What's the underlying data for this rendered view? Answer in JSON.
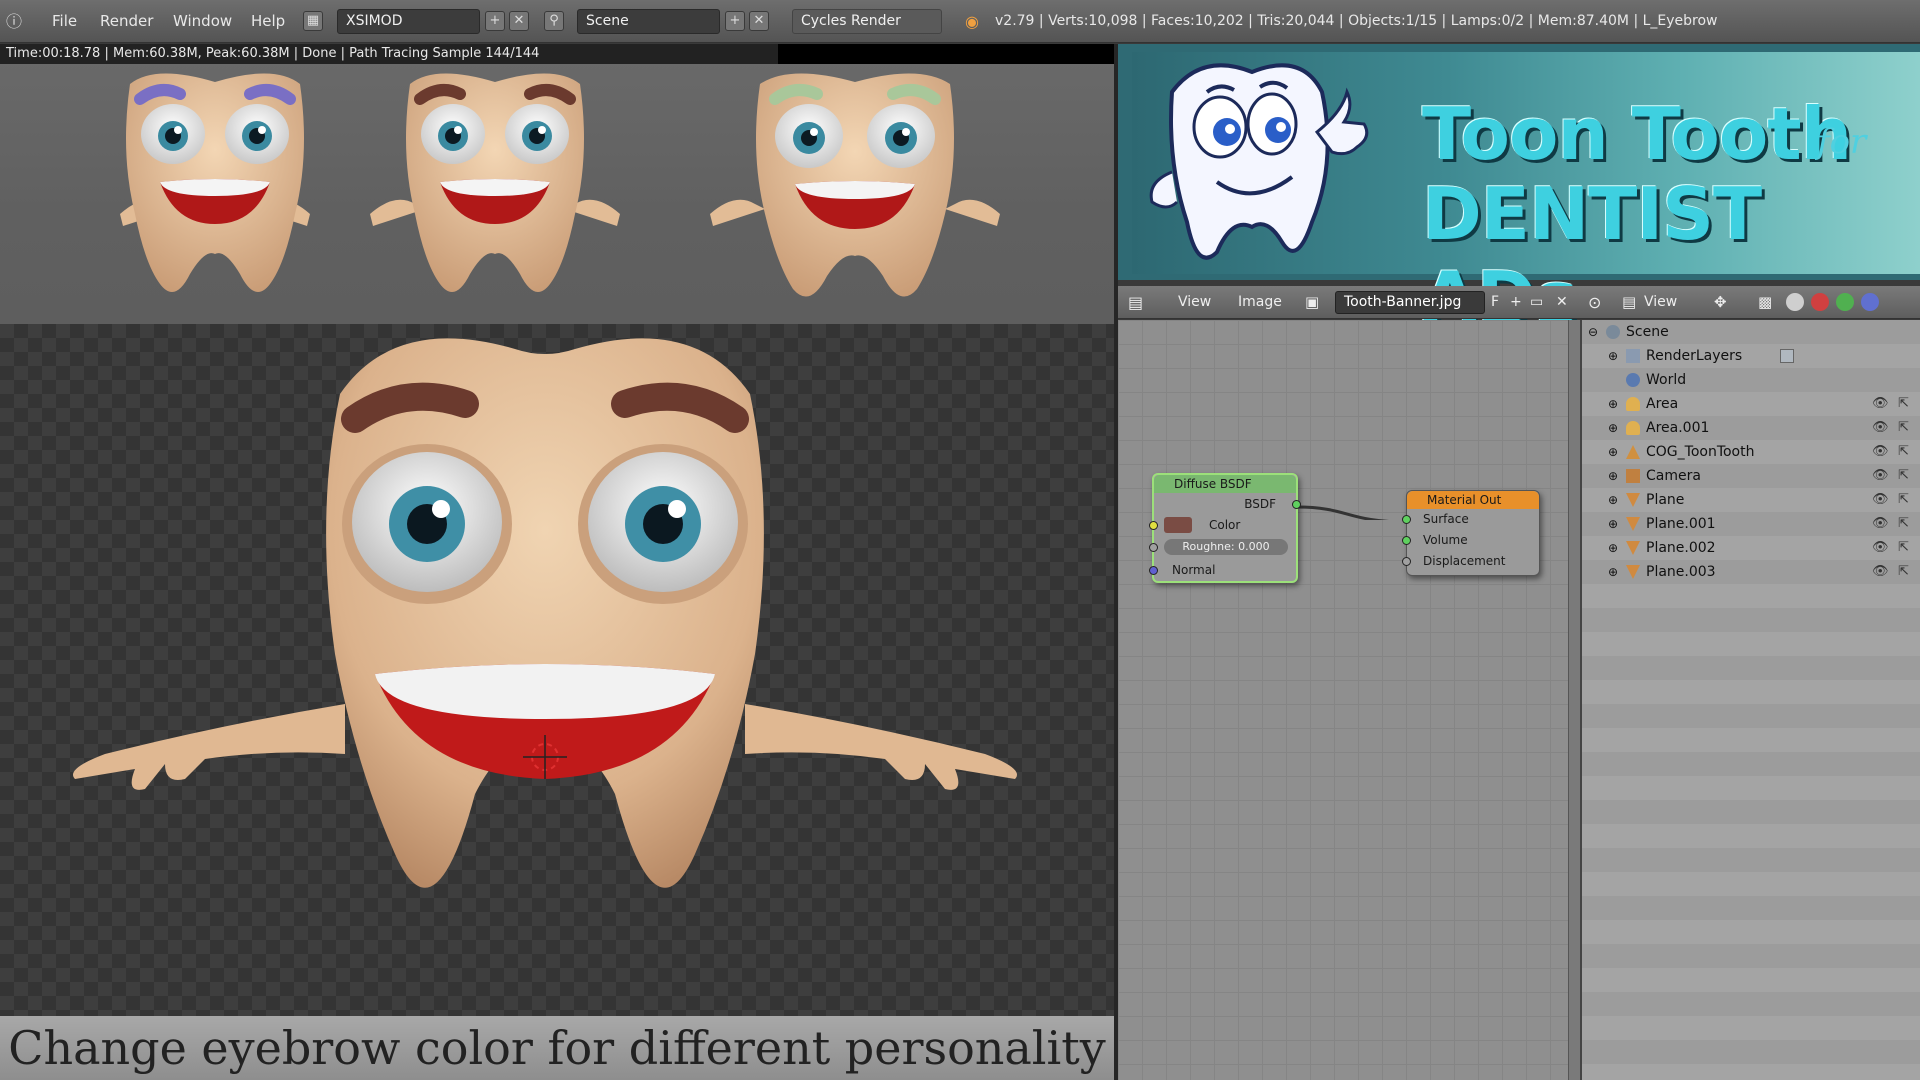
{
  "menubar": {
    "items": [
      "File",
      "Render",
      "Window",
      "Help"
    ],
    "screen_layout": "XSIMOD",
    "scene": "Scene",
    "engine": "Cycles Render",
    "stats": "v2.79 | Verts:10,098 | Faces:10,202 | Tris:20,044 | Objects:1/15 | Lamps:0/2 | Mem:87.40M | L_Eyebrow"
  },
  "render_info": {
    "text": "Time:00:18.78 | Mem:60.38M, Peak:60.38M | Done | Path Tracing Sample 144/144"
  },
  "caption": {
    "text": "Change eyebrow color for different personality"
  },
  "banner": {
    "title_line1": "Toon Tooth",
    "title_for": "for",
    "title_line2": "DENTIST ADs"
  },
  "image_editor": {
    "menu_view": "View",
    "menu_image": "Image",
    "image_name": "Tooth-Banner.jpg",
    "fake_user": "F",
    "view_label": "View"
  },
  "nodes": {
    "diffuse": {
      "title": "Diffuse BSDF",
      "output": "BSDF",
      "color_label": "Color",
      "roughness": "Roughne: 0.000",
      "normal": "Normal"
    },
    "material_out": {
      "title": "Material Out",
      "surface": "Surface",
      "volume": "Volume",
      "displacement": "Displacement"
    }
  },
  "outliner": {
    "rows": [
      {
        "name": "Scene",
        "icon": "scene-icon"
      },
      {
        "name": "RenderLayers",
        "icon": "render-layers-icon"
      },
      {
        "name": "World",
        "icon": "world-icon"
      },
      {
        "name": "Area",
        "icon": "lamp-icon"
      },
      {
        "name": "Area.001",
        "icon": "lamp-icon"
      },
      {
        "name": "COG_ToonTooth",
        "icon": "armature-icon"
      },
      {
        "name": "Camera",
        "icon": "camera-icon"
      },
      {
        "name": "Plane",
        "icon": "mesh-icon"
      },
      {
        "name": "Plane.001",
        "icon": "mesh-icon"
      },
      {
        "name": "Plane.002",
        "icon": "mesh-icon"
      },
      {
        "name": "Plane.003",
        "icon": "mesh-icon"
      }
    ]
  },
  "colors": {
    "eyebrow_purple": "#7a6fc4",
    "eyebrow_brown": "#6b3a2e",
    "eyebrow_green": "#a9c79a",
    "tooth_skin": "#e6c4a0",
    "node_diffuse_header": "#7ab870",
    "node_output_header": "#e8902a"
  }
}
